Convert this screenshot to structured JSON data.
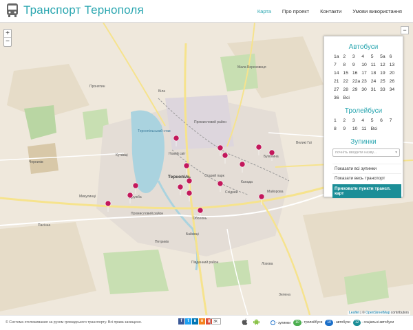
{
  "header": {
    "title": "Транспорт Тернополя",
    "menu": [
      {
        "label": "Карта",
        "active": true
      },
      {
        "label": "Про проект"
      },
      {
        "label": "Контакти"
      },
      {
        "label": "Умови використання"
      }
    ]
  },
  "map": {
    "zoom_in": "+",
    "zoom_out": "−",
    "labels": {
      "city": "Тернопіль",
      "nove_selo": "Новий світ",
      "druzhba": "Дружба",
      "vostok": "Східний",
      "kutkivtsi": "Кутківці",
      "pronyatyn": "Пронятин",
      "petrykiv": "Петриків",
      "pasichna": "Пасічна",
      "bilohirka": "Біла",
      "baikivtsi": "Байківці",
      "bukovyna": "Буковина",
      "kanada": "Канада",
      "staryi_park": "Старий парк",
      "obolon": "Оболонь",
      "zhovtneve": "Промисловий район",
      "mykulynets": "Микулинці",
      "ternopil_lake": "Тернопільський став",
      "mala_berezovytsia": "Мала Березовиця",
      "velyki_hai": "Великі Гаї",
      "lozova": "Лозова",
      "maiorova": "Майорова",
      "pivdennyi": "Південний район",
      "ternopil_industrial": "Промисловий район",
      "zelena": "Зелена",
      "chernykhiv": "Чернихів"
    }
  },
  "panel": {
    "collapse": "−",
    "buses_title": "Автобуси",
    "buses": [
      "1a",
      "2",
      "3",
      "4",
      "5",
      "5a",
      "6",
      "7",
      "8",
      "9",
      "10",
      "11",
      "12",
      "13",
      "14",
      "15",
      "16",
      "17",
      "18",
      "19",
      "20",
      "21",
      "22",
      "22a",
      "23",
      "24",
      "25",
      "26",
      "27",
      "28",
      "29",
      "30",
      "31",
      "33",
      "34",
      "36",
      "Всі"
    ],
    "trolleys_title": "Тролейбуси",
    "trolleys": [
      "1",
      "2",
      "3",
      "4",
      "5",
      "6",
      "7",
      "8",
      "9",
      "10",
      "11",
      "Всі"
    ],
    "stops_title": "Зупинки",
    "stops_placeholder": "почніть вводити назву...",
    "show_all_stops": "Показати всі зупинки",
    "show_all_transport": "Показати весь транспорт",
    "hide_points": "Приховати пункти трансп. карт"
  },
  "attribution": {
    "leaflet": "Leaflet",
    "sep": " | © ",
    "osm": "OpenStreetMap",
    "contributors": " contributors"
  },
  "footer": {
    "copyright": "© Система отслеживания за рухом громадського транспорту. Всі права захищено.",
    "counter": "3K",
    "legend_stops": "- зупинки",
    "legend_trolley": "- тролейбуси",
    "legend_bus": "- автобуси",
    "legend_social": "- соціальні автобуси",
    "badge_trolley": "10",
    "badge_bus": "10",
    "badge_social": "12"
  },
  "colors": {
    "accent": "#2aa6b0",
    "marker": "#c2185b",
    "trolley_badge": "#4caf50",
    "bus_badge": "#1b6fc9",
    "social_badge": "#1b8e97"
  }
}
